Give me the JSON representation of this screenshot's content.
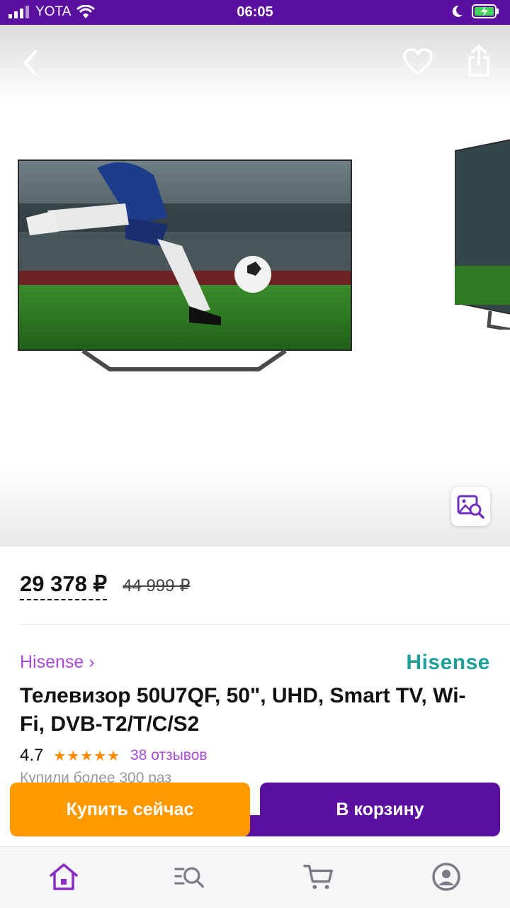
{
  "status_bar": {
    "carrier": "YOTA",
    "time": "06:05"
  },
  "product": {
    "price_current": "29 378 ₽",
    "price_old": "44 999 ₽",
    "brand_link": "Hisense ›",
    "brand_logo": "Hisense",
    "title": "Телевизор 50U7QF, 50\", UHD, Smart TV, Wi-Fi, DVB-T2/T/C/S2",
    "rating": "4.7",
    "stars": "★★★★★",
    "reviews": "38 отзывов",
    "bought": "Купили более 300 раз"
  },
  "actions": {
    "buy_now": "Купить сейчас",
    "add_to_cart": "В корзину"
  },
  "bottom_nav": [
    "home-icon",
    "catalog-search-icon",
    "cart-icon",
    "profile-icon"
  ],
  "colors": {
    "brand_purple": "#5a0fa1",
    "accent_orange": "#ff9900",
    "link_purple": "#a94bd6",
    "star_orange": "#ff8a00",
    "hisense_teal": "#1e9f97"
  }
}
